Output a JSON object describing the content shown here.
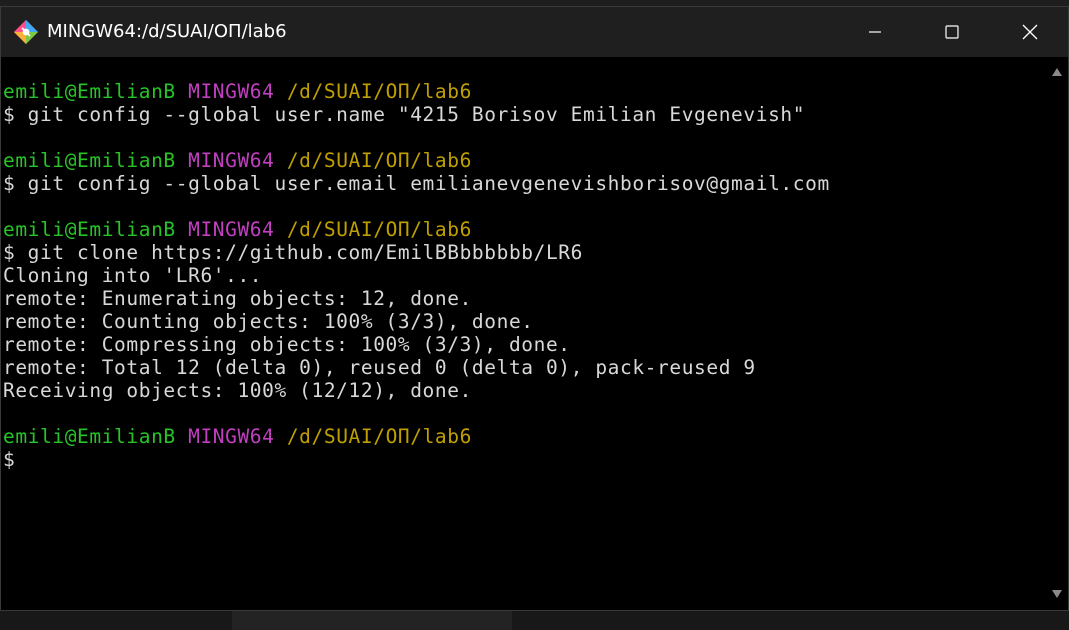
{
  "window": {
    "title": "MINGW64:/d/SUAI/ОП/lab6",
    "icon": "git-bash-icon",
    "controls": [
      "minimize-icon",
      "maximize-icon",
      "close-icon"
    ]
  },
  "colors": {
    "user_host": "#26c426",
    "mingw": "#c040c0",
    "path": "#c0a000",
    "text": "#d8d8d8"
  },
  "terminal": {
    "blocks": [
      {
        "prompt": {
          "user_host": "emili@EmilianB",
          "env": "MINGW64",
          "path": "/d/SUAI/ОП/lab6"
        },
        "command": "$ git config --global user.name \"4215 Borisov Emilian Evgenevish\"",
        "output": []
      },
      {
        "prompt": {
          "user_host": "emili@EmilianB",
          "env": "MINGW64",
          "path": "/d/SUAI/ОП/lab6"
        },
        "command": "$ git config --global user.email emilianevgenevishborisov@gmail.com",
        "output": []
      },
      {
        "prompt": {
          "user_host": "emili@EmilianB",
          "env": "MINGW64",
          "path": "/d/SUAI/ОП/lab6"
        },
        "command": "$ git clone https://github.com/EmilBBbbbbbb/LR6",
        "output": [
          "Cloning into 'LR6'...",
          "remote: Enumerating objects: 12, done.",
          "remote: Counting objects: 100% (3/3), done.",
          "remote: Compressing objects: 100% (3/3), done.",
          "remote: Total 12 (delta 0), reused 0 (delta 0), pack-reused 9",
          "Receiving objects: 100% (12/12), done."
        ]
      },
      {
        "prompt": {
          "user_host": "emili@EmilianB",
          "env": "MINGW64",
          "path": "/d/SUAI/ОП/lab6"
        },
        "command": "$",
        "output": []
      }
    ]
  }
}
